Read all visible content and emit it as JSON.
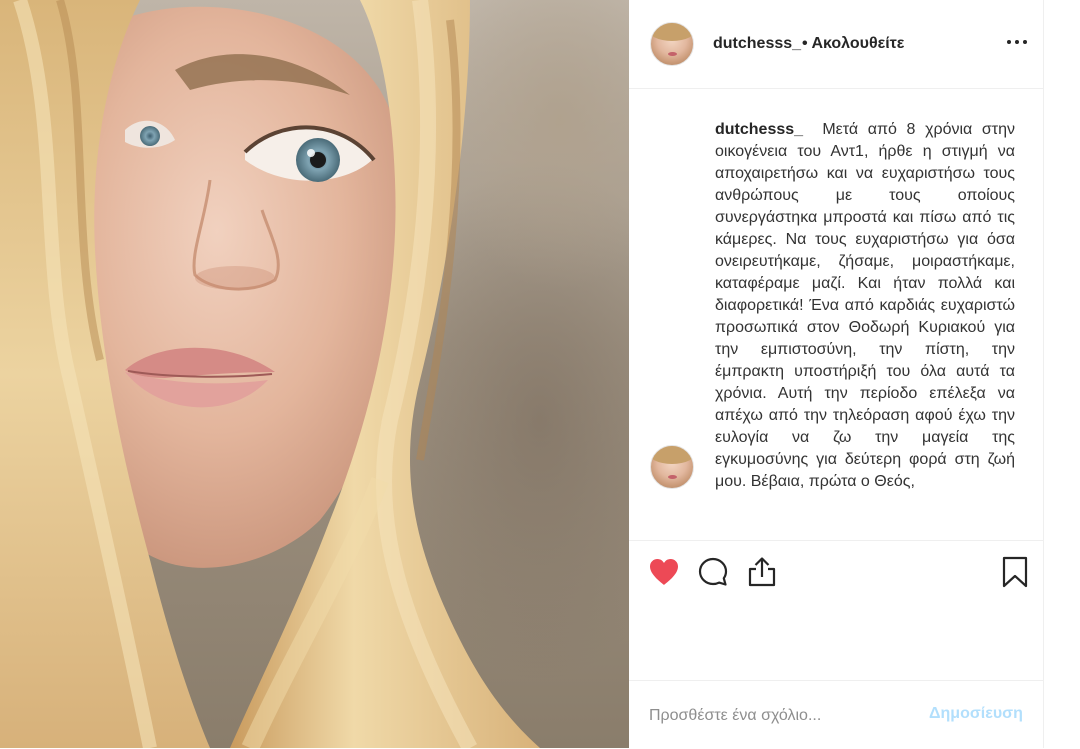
{
  "post": {
    "image_alt": "Portrait photo of a blonde woman",
    "author": {
      "username": "dutchesss_",
      "follow_status": "• Ακολουθείτε"
    },
    "caption": {
      "username": "dutchesss_",
      "text": "Μετά από 8 χρόνια στην οικογένεια του Αντ1, ήρθε η στιγμή να αποχαιρετήσω και να ευχαριστήσω τους ανθρώπους με τους οποίους συνεργάστηκα μπροστά και πίσω από τις κάμερες. Να τους ευχαριστήσω για όσα ονειρευτήκαμε, ζήσαμε, μοιραστήκαμε, καταφέραμε μαζί. Και ήταν πολλά και διαφορετικά! Ένα από καρδιάς ευχαριστώ προσωπικά στον Θοδωρή Κυριακού για την εμπιστοσύνη, την πίστη, την έμπρακτη υποστήριξή του όλα αυτά τα χρόνια. Αυτή την περίοδο επέλεξα να απέχω από την τηλεόραση αφού έχω την ευλογία να ζω την μαγεία της εγκυμοσύνης για δεύτερη φορά στη ζωή μου. Βέβαια, πρώτα ο Θεός,"
    },
    "actions": {
      "like_icon": "heart-filled-icon",
      "like_color": "#ed4956",
      "comment_icon": "comment-icon",
      "share_icon": "share-icon",
      "save_icon": "bookmark-icon"
    },
    "comment_form": {
      "placeholder": "Προσθέστε ένα σχόλιο...",
      "submit_label": "Δημοσίευση",
      "submit_color": "#b2dffc"
    }
  }
}
